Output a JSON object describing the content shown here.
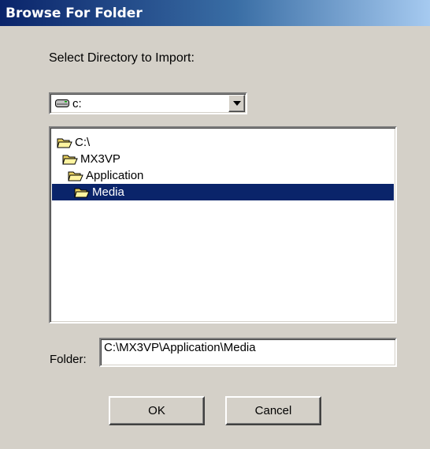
{
  "window": {
    "title": "Browse For Folder"
  },
  "prompt": "Select Directory to Import:",
  "drive_select": {
    "value": "c:",
    "icon": "drive-icon"
  },
  "tree": {
    "items": [
      {
        "label": "C:\\",
        "icon": "open-folder-icon",
        "selected": false
      },
      {
        "label": "MX3VP",
        "icon": "open-folder-icon",
        "selected": false
      },
      {
        "label": "Application",
        "icon": "open-folder-icon",
        "selected": false
      },
      {
        "label": "Media",
        "icon": "open-folder-icon",
        "selected": true
      }
    ]
  },
  "folder": {
    "label": "Folder:",
    "value": "C:\\MX3VP\\Application\\Media"
  },
  "buttons": {
    "ok": "OK",
    "cancel": "Cancel"
  },
  "colors": {
    "selection": "#0a246a",
    "face": "#d4d0c8",
    "title_start": "#0a246a",
    "title_end": "#a6caf0"
  }
}
